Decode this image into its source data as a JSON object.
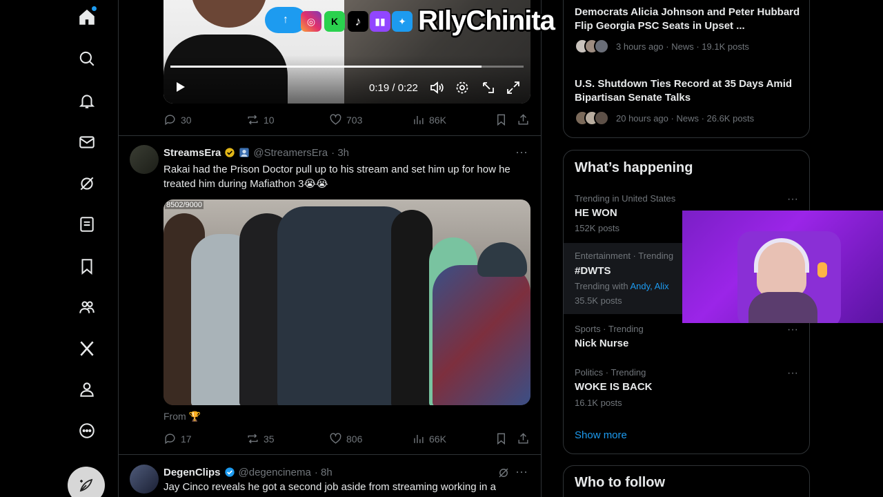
{
  "colors": {
    "accent": "#1d9bf0",
    "muted": "#71767b",
    "border": "#2f3336"
  },
  "nav": {
    "items": [
      "home-icon",
      "explore-icon",
      "notifications-icon",
      "messages-icon",
      "grok-icon",
      "lists-icon",
      "bookmarks-icon",
      "communities-icon",
      "x-premium-icon",
      "profile-icon",
      "more-icon"
    ],
    "compose": "compose-icon"
  },
  "timeline": {
    "tweet1": {
      "video_time": "0:19 / 0:22",
      "video_progress": 0.88,
      "stats": {
        "replies": "30",
        "reposts": "10",
        "likes": "703",
        "views": "86K"
      }
    },
    "tweet2": {
      "name": "StreamsEra",
      "handle": "@StreamersEra",
      "time": "· 3h",
      "text": "Rakai had the Prison Doctor pull up to his stream and set him up for how he treated him during Mafiathon 3😭😭",
      "video_counter": "8502/9000",
      "from_label": "From 🏆",
      "stats": {
        "replies": "17",
        "reposts": "35",
        "likes": "806",
        "views": "66K"
      }
    },
    "tweet3": {
      "name": "DegenClips",
      "handle": "@degencinema",
      "time": "· 8h",
      "text": "Jay Cinco reveals he got a second job aside from streaming working in a"
    }
  },
  "news": [
    {
      "title": "Democrats Alicia Johnson and Peter Hubbard Flip Georgia PSC Seats in Upset ...",
      "meta": "3 hours ago · News · 19.1K posts"
    },
    {
      "title": "U.S. Shutdown Ties Record at 35 Days Amid Bipartisan Senate Talks",
      "meta": "20 hours ago · News · 26.6K posts"
    }
  ],
  "whats_happening": {
    "heading": "What’s happening",
    "trends": [
      {
        "category": "Trending in United States",
        "name": "HE WON",
        "count": "152K posts"
      },
      {
        "category": "Entertainment · Trending",
        "name": "#DWTS",
        "with_label": "Trending with",
        "with_names": "Andy, Alix",
        "count": "35.5K posts"
      },
      {
        "category": "Sports · Trending",
        "name": "Nick Nurse"
      },
      {
        "category": "Politics · Trending",
        "name": "WOKE IS BACK",
        "count": "16.1K posts"
      }
    ],
    "show_more": "Show more"
  },
  "who_to_follow": {
    "heading": "Who to follow"
  },
  "overlay": {
    "brand_name": "RIlyChinita",
    "brand_icons": [
      "instagram-icon",
      "kick-icon",
      "tiktok-icon",
      "twitch-icon",
      "twitter-icon"
    ],
    "scroll_up": "↑"
  }
}
